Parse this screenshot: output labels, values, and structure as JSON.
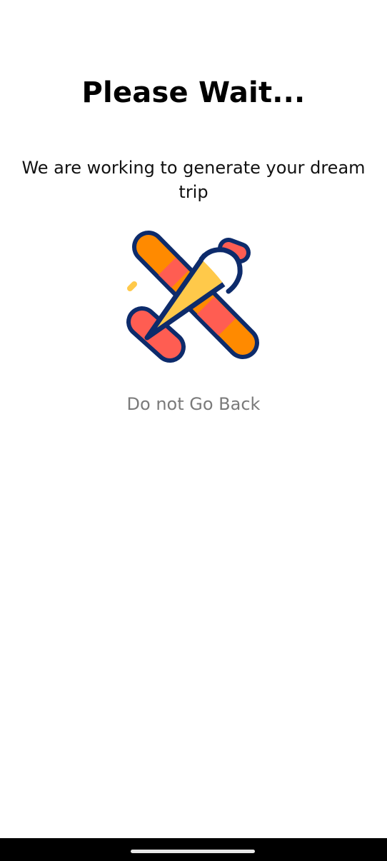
{
  "screen": {
    "title": "Please Wait...",
    "subtitle": "We are working to generate your dream trip",
    "hint": "Do not Go Back"
  },
  "illustration": {
    "icon": "airplane-icon",
    "colors": {
      "outline": "#0d2b6b",
      "wing_orange": "#ff8a00",
      "wing_red": "#ff5d52",
      "cone_yellow": "#ffc94a",
      "nose_white": "#ffffff"
    }
  },
  "system": {
    "nav_background": "#000000",
    "home_indicator_color": "#e8e8e8"
  }
}
